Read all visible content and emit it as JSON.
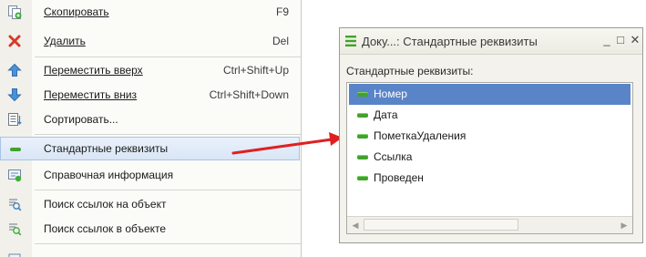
{
  "menu": {
    "items": [
      {
        "id": "copy",
        "label": "Скопировать",
        "shortcut": "F9"
      },
      {
        "id": "delete",
        "label": "Удалить",
        "shortcut": "Del"
      },
      {
        "id": "up",
        "label": "Переместить вверх",
        "shortcut": "Ctrl+Shift+Up"
      },
      {
        "id": "down",
        "label": "Переместить вниз",
        "shortcut": "Ctrl+Shift+Down"
      },
      {
        "id": "sort",
        "label": "Сортировать...",
        "shortcut": ""
      },
      {
        "id": "std",
        "label": "Стандартные реквизиты",
        "shortcut": ""
      },
      {
        "id": "info",
        "label": "Справочная информация",
        "shortcut": ""
      },
      {
        "id": "findto",
        "label": "Поиск ссылок на объект",
        "shortcut": ""
      },
      {
        "id": "findin",
        "label": "Поиск ссылок в объекте",
        "shortcut": ""
      }
    ]
  },
  "dialog": {
    "title": "Доку...: Стандартные реквизиты",
    "minimize": "_",
    "maximize": "□",
    "close": "✕",
    "caption": "Стандартные реквизиты:",
    "items": [
      "Номер",
      "Дата",
      "ПометкаУдаления",
      "Ссылка",
      "Проведен"
    ],
    "selected": "Номер"
  },
  "colors": {
    "selection": "#5a84c8",
    "accent_green": "#41a32a",
    "arrow": "#e02020"
  }
}
